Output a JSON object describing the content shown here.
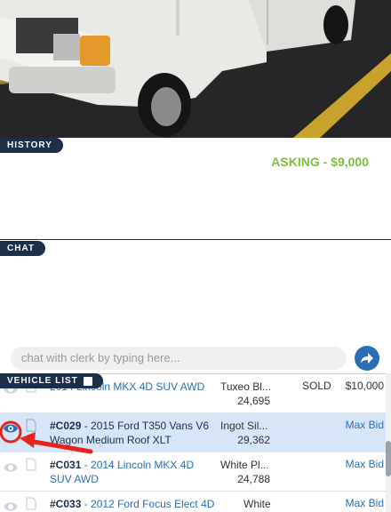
{
  "history": {
    "tag": "HISTORY",
    "asking": "ASKING - $9,000"
  },
  "chat": {
    "tag": "CHAT",
    "placeholder": "chat with clerk by typing here..."
  },
  "vehicle_list": {
    "tag": "VEHICLE LIST",
    "rows": [
      {
        "id": "",
        "title": "2014 Lincoln MKX 4D SUV AWD",
        "color": "Tuxeo Bl...",
        "miles": "24,695",
        "status": "SOLD",
        "price": "$10,000"
      },
      {
        "id": "#C029",
        "title": " - 2015 Ford T350 Vans V6 Wagon Medium Roof XLT",
        "color": "Ingot Sil...",
        "miles": "29,362",
        "status": "",
        "price": "Max Bid"
      },
      {
        "id": "#C031",
        "title": " - 2014 Lincoln MKX 4D SUV AWD",
        "color": "White Pl...",
        "miles": "24,788",
        "status": "",
        "price": "Max Bid"
      },
      {
        "id": "#C033",
        "title": " - 2012 Ford Focus Elect 4D",
        "color": "White",
        "miles": "",
        "status": "",
        "price": "Max Bid"
      }
    ]
  },
  "colors": {
    "navy": "#1d2e4a",
    "green": "#7cbf3e",
    "blue": "#2a6fb5",
    "selected_row": "#d6e6f8",
    "annotation": "#e8231a"
  },
  "icons": {
    "send": "arrow-forward-icon",
    "view": "eye-icon",
    "doc": "document-icon"
  }
}
